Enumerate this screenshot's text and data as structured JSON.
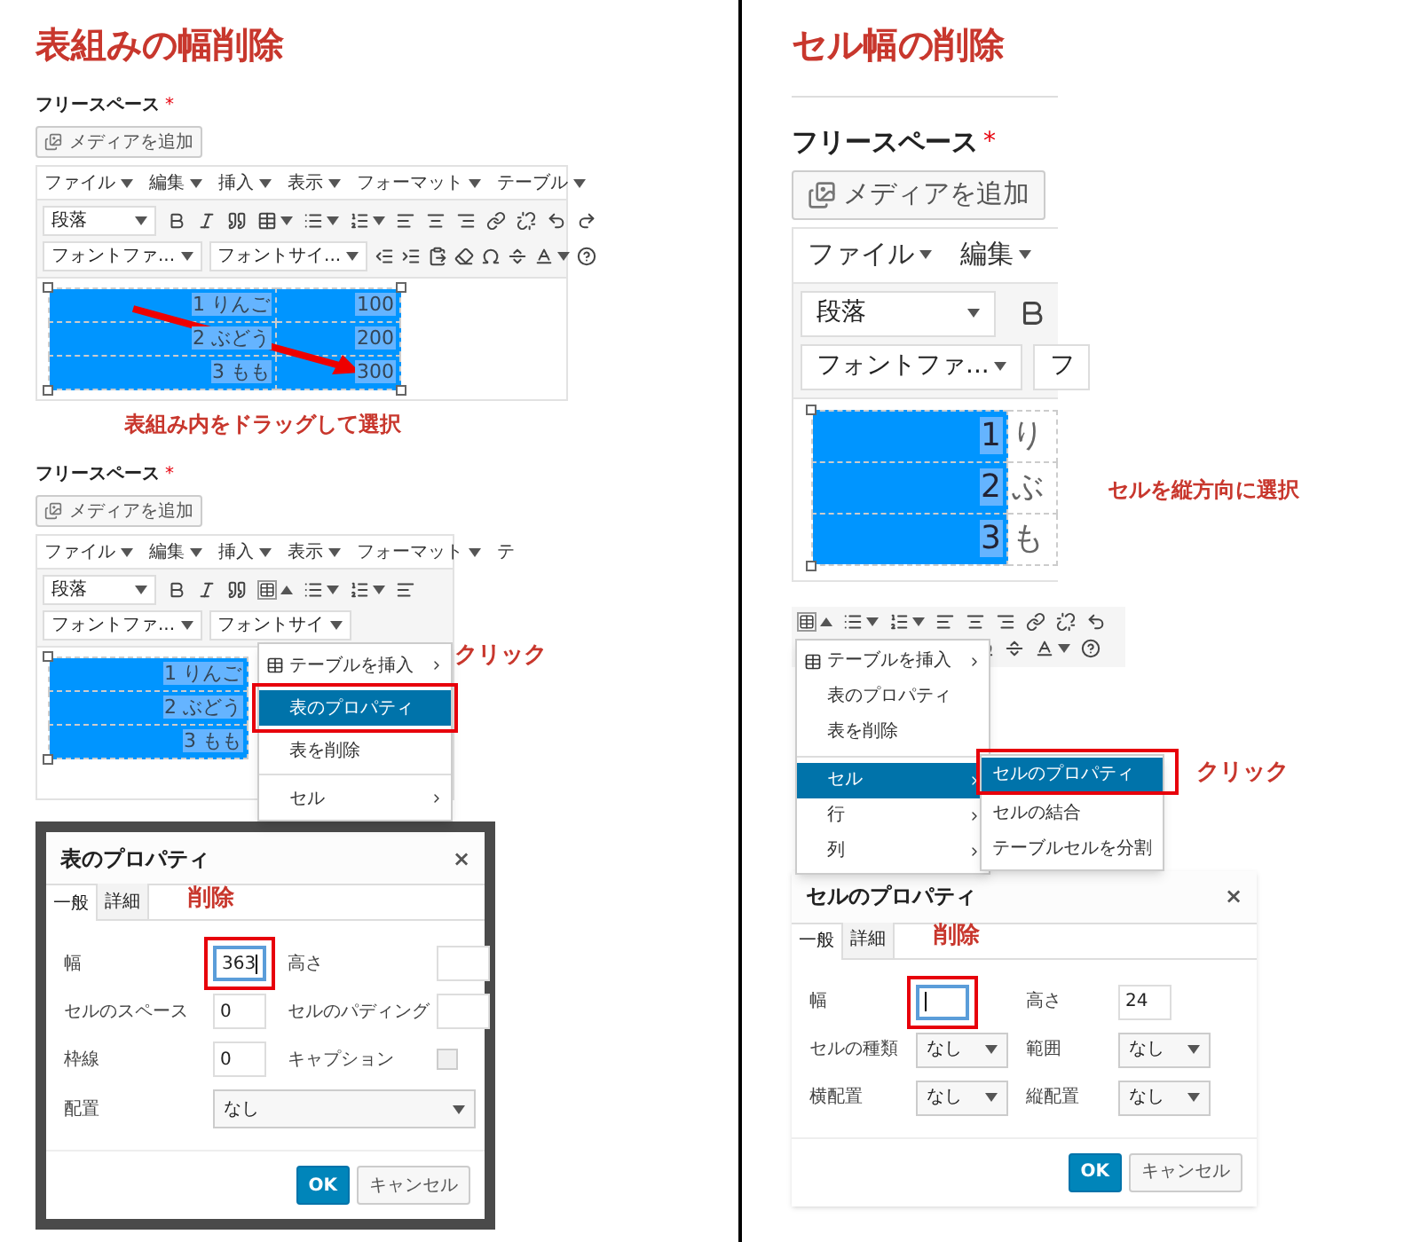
{
  "sections": [
    {
      "heading": "表組みの幅削除",
      "steps": [
        {
          "kind": "editor",
          "field_label": "フリースペース",
          "required_mark": "*",
          "media_button": "メディアを追加",
          "menus": [
            "ファイル",
            "編集",
            "挿入",
            "表示",
            "フォーマット",
            "テーブル"
          ],
          "format_select": "段落",
          "font_selects": [
            "フォントファ...",
            "フォントサイ..."
          ],
          "table_rows": [
            [
              {
                "text": "1 りんご",
                "selected": true
              },
              {
                "text": "100",
                "selected": true
              }
            ],
            [
              {
                "text": "2 ぶどう",
                "selected": true
              },
              {
                "text": "200",
                "selected": true
              }
            ],
            [
              {
                "text": "3 もも",
                "selected": true
              },
              {
                "text": "300",
                "selected": true
              }
            ]
          ],
          "drag_arrow": true,
          "note": "表組み内をドラッグして選択"
        },
        {
          "kind": "editor",
          "field_label": "フリースペース",
          "required_mark": "*",
          "media_button": "メディアを追加",
          "menus": [
            "ファイル",
            "編集",
            "挿入",
            "表示",
            "フォーマット",
            "テ"
          ],
          "format_select": "段落",
          "font_selects": [
            "フォントファ...",
            "フォントサイ"
          ],
          "table_rows": [
            [
              {
                "text": "1 りんご",
                "selected": true
              }
            ],
            [
              {
                "text": "2 ぶどう",
                "selected": true
              }
            ],
            [
              {
                "text": "3 もも",
                "selected": true
              }
            ]
          ],
          "table_menu": {
            "items": [
              {
                "label": "テーブルを挿入",
                "kind": "insert",
                "submenu": true,
                "selected": false
              },
              {
                "label": "表のプロパティ",
                "kind": "plain",
                "submenu": false,
                "selected": true
              },
              {
                "label": "表を削除",
                "kind": "plain",
                "submenu": false,
                "selected": false
              },
              {
                "label": "セル",
                "kind": "divided",
                "submenu": true,
                "selected": false
              }
            ],
            "callout": "クリック"
          }
        },
        {
          "kind": "dialog",
          "framed": true,
          "title": "表のプロパティ",
          "close": "×",
          "tabs": [
            {
              "label": "一般",
              "selected": true
            },
            {
              "label": "詳細",
              "selected": false
            }
          ],
          "tab_note": "削除",
          "rows": [
            [
              {
                "label": "幅",
                "kind": "input",
                "value": "363",
                "focused": true,
                "highlighted": true
              },
              {
                "label": "高さ",
                "kind": "input",
                "focused": false,
                "highlighted": false
              }
            ],
            [
              {
                "label": "セルのスペース",
                "kind": "input",
                "value": "0",
                "focused": false,
                "highlighted": false
              },
              {
                "label": "セルのパディング",
                "kind": "input",
                "focused": false,
                "highlighted": false
              }
            ],
            [
              {
                "label": "枠線",
                "kind": "input",
                "value": "0",
                "focused": false,
                "highlighted": false
              },
              {
                "label": "キャプション",
                "kind": "checkbox",
                "checked": false
              }
            ],
            [
              {
                "label": "配置",
                "kind": "select",
                "value": "なし"
              }
            ]
          ],
          "buttons": [
            {
              "label": "OK",
              "kind": "primary"
            },
            {
              "label": "キャンセル",
              "kind": "secondary"
            }
          ]
        }
      ]
    },
    {
      "heading": "セル幅の削除",
      "steps": [
        {
          "kind": "editor_cropped",
          "field_label": "フリースペース",
          "required_mark": "*",
          "media_button": "メディアを追加",
          "menus": [
            "ファイル",
            "編集"
          ],
          "format_select": "段落",
          "font_selects": [
            "フォントファ...",
            "フ"
          ],
          "table_rows": [
            [
              {
                "text": "1",
                "selected": true
              },
              {
                "text": "り",
                "selected": false
              }
            ],
            [
              {
                "text": "2",
                "selected": true
              },
              {
                "text": "ぶ",
                "selected": false
              }
            ],
            [
              {
                "text": "3",
                "selected": true
              },
              {
                "text": "も",
                "selected": false
              }
            ]
          ],
          "note": "セルを縦方向に選択"
        },
        {
          "kind": "menu",
          "items": [
            {
              "label": "テーブルを挿入",
              "kind": "insert",
              "submenu": true,
              "selected": false
            },
            {
              "label": "表のプロパティ",
              "kind": "plain",
              "submenu": false,
              "selected": false
            },
            {
              "label": "表を削除",
              "kind": "plain",
              "submenu": false,
              "selected": false
            },
            {
              "label": "セル",
              "kind": "divided",
              "submenu": true,
              "selected": true
            },
            {
              "label": "行",
              "kind": "plain",
              "submenu": true,
              "selected": false
            },
            {
              "label": "列",
              "kind": "plain",
              "submenu": true,
              "selected": false
            }
          ],
          "submenu_items": [
            {
              "label": "セルのプロパティ",
              "selected": true
            },
            {
              "label": "セルの結合",
              "selected": false
            },
            {
              "label": "テーブルセルを分割",
              "selected": false
            }
          ],
          "callout": "クリック"
        },
        {
          "kind": "dialog",
          "framed": false,
          "title": "セルのプロパティ",
          "close": "×",
          "tabs": [
            {
              "label": "一般",
              "selected": true
            },
            {
              "label": "詳細",
              "selected": false
            }
          ],
          "tab_note": "削除",
          "rows": [
            [
              {
                "label": "幅",
                "kind": "input",
                "focused": true,
                "highlighted": true
              },
              {
                "label": "高さ",
                "kind": "input",
                "value": "24",
                "focused": false,
                "highlighted": false
              }
            ],
            [
              {
                "label": "セルの種類",
                "kind": "select",
                "value": "なし"
              },
              {
                "label": "範囲",
                "kind": "select",
                "value": "なし"
              }
            ],
            [
              {
                "label": "横配置",
                "kind": "select",
                "value": "なし"
              },
              {
                "label": "縦配置",
                "kind": "select",
                "value": "なし"
              }
            ]
          ],
          "buttons": [
            {
              "label": "OK",
              "kind": "primary"
            },
            {
              "label": "キャンセル",
              "kind": "secondary"
            }
          ]
        }
      ]
    }
  ]
}
